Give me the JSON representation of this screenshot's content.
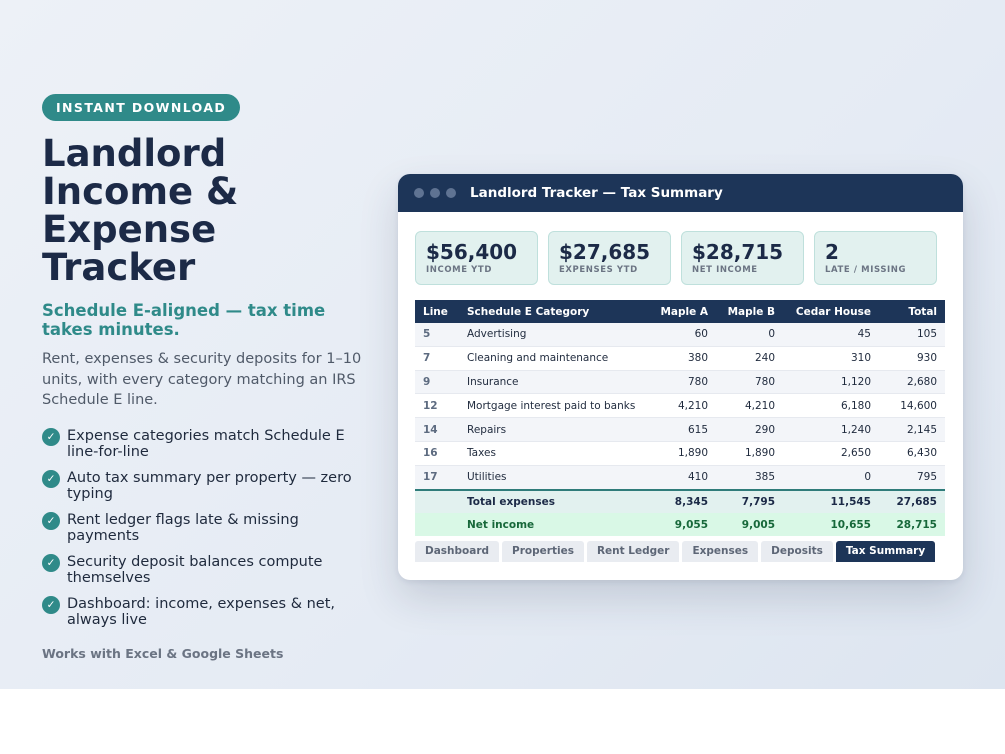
{
  "hero": {
    "badge": "INSTANT DOWNLOAD",
    "title": "Landlord Income & Expense Tracker",
    "subtitle": "Schedule E-aligned — tax time takes minutes.",
    "description": "Rent, expenses & security deposits for 1–10 units, with every category matching an IRS Schedule E line.",
    "features": [
      "Expense categories match Schedule E line-for-line",
      "Auto tax summary per property — zero typing",
      "Rent ledger flags late & missing payments",
      "Security deposit balances compute themselves",
      "Dashboard: income, expenses & net, always live"
    ],
    "check_glyph": "✓",
    "footnote": "Works with Excel & Google Sheets"
  },
  "window": {
    "title": "Landlord Tracker — Tax Summary",
    "cards": [
      {
        "value": "$56,400",
        "label": "INCOME YTD"
      },
      {
        "value": "$27,685",
        "label": "EXPENSES YTD"
      },
      {
        "value": "$28,715",
        "label": "NET INCOME"
      },
      {
        "value": "2",
        "label": "LATE / MISSING"
      }
    ],
    "table": {
      "headers": [
        "Line",
        "Schedule E Category",
        "Maple A",
        "Maple B",
        "Cedar House",
        "Total"
      ],
      "rows": [
        [
          "5",
          "Advertising",
          "60",
          "0",
          "45",
          "105"
        ],
        [
          "7",
          "Cleaning and maintenance",
          "380",
          "240",
          "310",
          "930"
        ],
        [
          "9",
          "Insurance",
          "780",
          "780",
          "1,120",
          "2,680"
        ],
        [
          "12",
          "Mortgage interest paid to banks",
          "4,210",
          "4,210",
          "6,180",
          "14,600"
        ],
        [
          "14",
          "Repairs",
          "615",
          "290",
          "1,240",
          "2,145"
        ],
        [
          "16",
          "Taxes",
          "1,890",
          "1,890",
          "2,650",
          "6,430"
        ],
        [
          "17",
          "Utilities",
          "410",
          "385",
          "0",
          "795"
        ]
      ],
      "total_row": [
        "",
        "Total expenses",
        "8,345",
        "7,795",
        "11,545",
        "27,685"
      ],
      "net_row": [
        "",
        "Net income",
        "9,055",
        "9,005",
        "10,655",
        "28,715"
      ]
    },
    "tabs": [
      "Dashboard",
      "Properties",
      "Rent Ledger",
      "Expenses",
      "Deposits",
      "Tax Summary"
    ],
    "active_tab": "Tax Summary"
  },
  "colors": {
    "accent": "#2f8a89",
    "navy": "#1d3558",
    "net_green": "#17683a"
  }
}
